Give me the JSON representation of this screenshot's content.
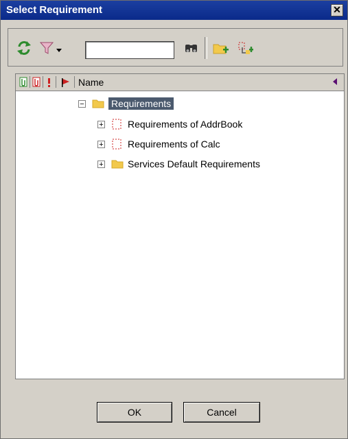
{
  "window": {
    "title": "Select Requirement",
    "close_glyph": "✕"
  },
  "toolbar": {
    "refresh_icon": "refresh-icon",
    "filter_icon": "filter-icon",
    "search_value": "",
    "find_icon": "binoculars-icon",
    "new_folder_icon": "new-folder-icon",
    "new_requirement_icon": "new-requirement-icon"
  },
  "tree": {
    "column_name": "Name",
    "root": {
      "label": "Requirements",
      "expanded": true,
      "selected": true
    },
    "children": [
      {
        "label": "Requirements of AddrBook",
        "type": "requirement"
      },
      {
        "label": "Requirements of Calc",
        "type": "requirement"
      },
      {
        "label": "Services Default Requirements",
        "type": "folder"
      }
    ]
  },
  "buttons": {
    "ok": "OK",
    "cancel": "Cancel"
  },
  "colors": {
    "title_bar": "#0a2a8a",
    "selection": "#4b5a6e",
    "folder": "#f2c94c"
  }
}
